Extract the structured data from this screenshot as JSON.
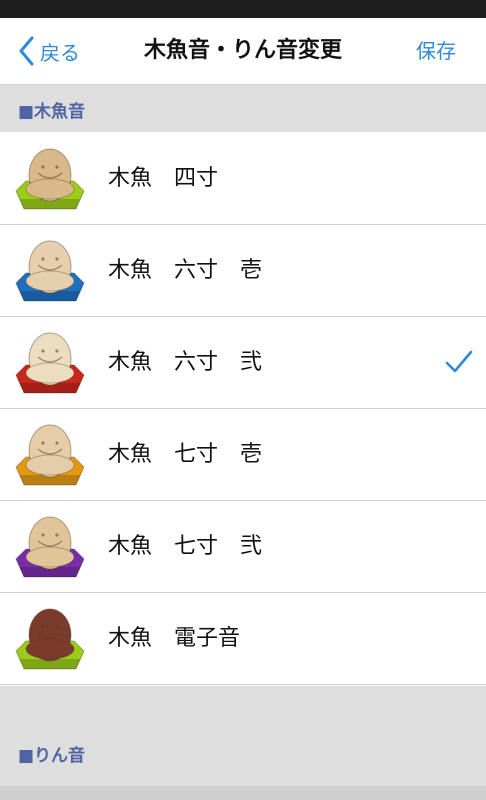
{
  "nav": {
    "back_label": "戻る",
    "title": "木魚音・りん音変更",
    "save_label": "保存"
  },
  "sections": [
    {
      "header": "■木魚音"
    },
    {
      "header": "■りん音"
    }
  ],
  "mokugyo_items": [
    {
      "label": "木魚　四寸",
      "base_color": "#9ccc1a",
      "head_color": "#d9b98a",
      "selected": false
    },
    {
      "label": "木魚　六寸　壱",
      "base_color": "#1f6fc1",
      "head_color": "#e6cfae",
      "selected": false
    },
    {
      "label": "木魚　六寸　弐",
      "base_color": "#c8281d",
      "head_color": "#ecdcc0",
      "selected": true
    },
    {
      "label": "木魚　七寸　壱",
      "base_color": "#e39a12",
      "head_color": "#e5cda8",
      "selected": false
    },
    {
      "label": "木魚　七寸　弐",
      "base_color": "#7b2ca8",
      "head_color": "#e0c59a",
      "selected": false
    },
    {
      "label": "木魚　電子音",
      "base_color": "#9ccc1a",
      "head_color": "#7a3a2c",
      "selected": false
    }
  ],
  "colors": {
    "accent": "#2d8ad8",
    "section_text": "#4f64a4",
    "section_bg": "#dedede"
  },
  "icons": {
    "back": "chevron-left-icon",
    "check": "checkmark-icon"
  }
}
